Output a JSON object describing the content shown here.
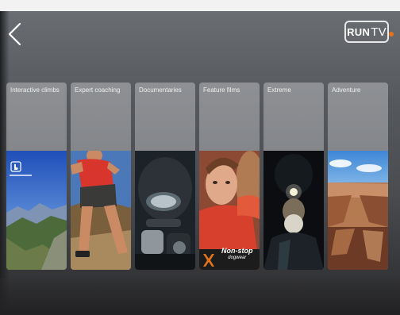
{
  "header": {
    "back_icon": "chevron-left-icon",
    "logo": {
      "run": "RUN",
      "tv": "TV"
    }
  },
  "categories": [
    {
      "label": "Interactive climbs",
      "icon": "hand-pointer-icon"
    },
    {
      "label": "Expert coaching"
    },
    {
      "label": "Documentaries"
    },
    {
      "label": "Feature films",
      "badge": {
        "brand": "Non-stop",
        "sub": "dogwear"
      }
    },
    {
      "label": "Extreme"
    },
    {
      "label": "Adventure"
    }
  ],
  "colors": {
    "accent": "#e5721d",
    "badge_bg": "#1c1c1c"
  }
}
